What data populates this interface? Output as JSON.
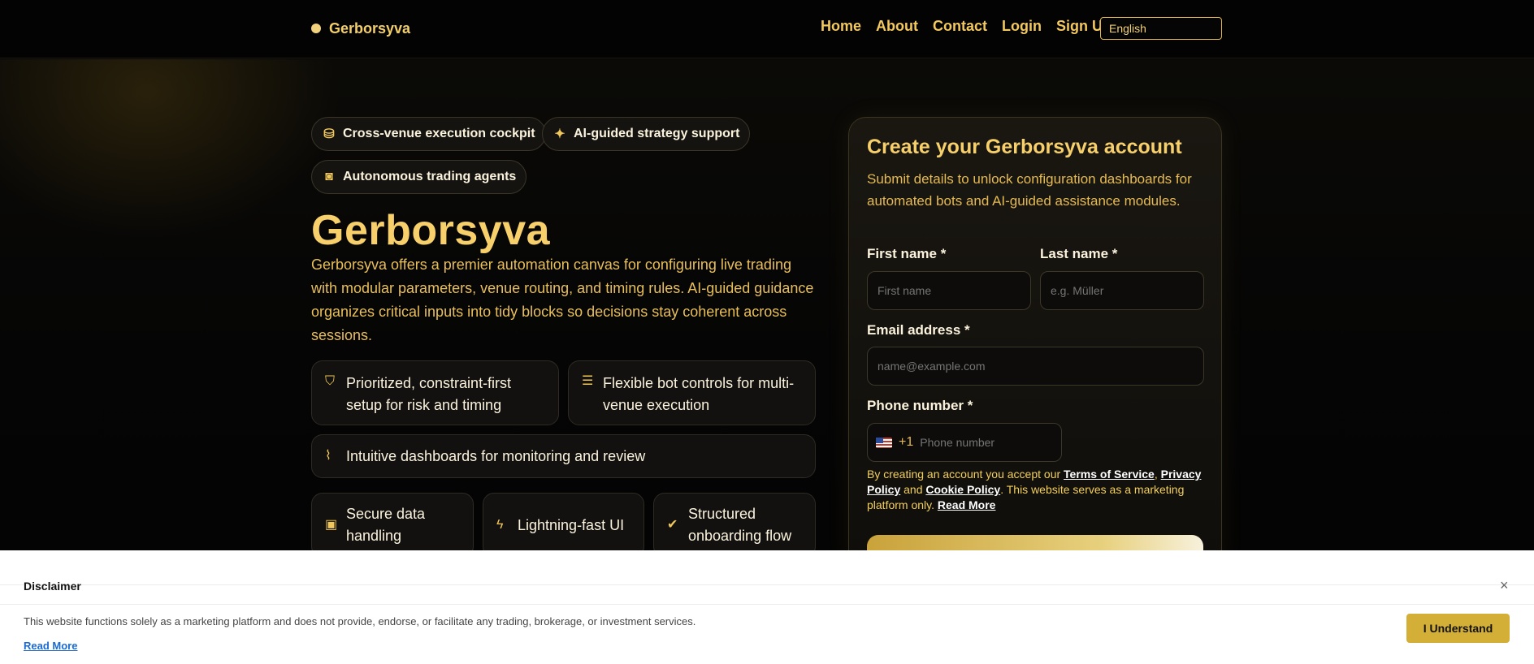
{
  "header": {
    "brand": "Gerborsyva",
    "nav": [
      "Home",
      "About",
      "Contact",
      "Login",
      "Sign Up"
    ],
    "language": "English"
  },
  "hero": {
    "pills": [
      {
        "label": "Cross-venue execution cockpit",
        "icon": "coins-icon"
      },
      {
        "label": "AI-guided strategy support",
        "icon": "magic-wand-icon"
      },
      {
        "label": "Autonomous trading agents",
        "icon": "robot-icon"
      }
    ],
    "title": "Gerborsyva",
    "lead": "Gerborsyva offers a premier automation canvas for configuring live trading with modular parameters, venue routing, and timing rules. AI-guided guidance organizes critical inputs into tidy blocks so decisions stay coherent across sessions.",
    "features": [
      {
        "label": "Prioritized, constraint-first setup for risk and timing",
        "icon": "shield-icon"
      },
      {
        "label": "Flexible bot controls for multi-venue execution",
        "icon": "sliders-icon"
      },
      {
        "label": "Intuitive dashboards for monitoring and review",
        "icon": "chart-line-icon"
      },
      {
        "label": "Secure data handling",
        "icon": "lock-icon"
      },
      {
        "label": "Lightning-fast UI",
        "icon": "bolt-icon"
      },
      {
        "label": "Structured onboarding flow",
        "icon": "check-circle-icon"
      }
    ]
  },
  "form": {
    "title": "Create your Gerborsyva account",
    "subtitle": "Submit details to unlock configuration dashboards for automated bots and AI-guided assistance modules.",
    "first_name_label": "First name *",
    "first_name_placeholder": "First name",
    "last_name_label": "Last name *",
    "last_name_placeholder": "e.g. Müller",
    "email_label": "Email address *",
    "email_placeholder": "name@example.com",
    "phone_label": "Phone number *",
    "phone_code": "+1",
    "phone_placeholder": "Phone number",
    "terms_prefix": "By creating an account you accept our ",
    "terms_of_service": "Terms of Service",
    "comma": ",",
    "privacy_policy": "Privacy Policy",
    "and": " and ",
    "cookie_policy": "Cookie Policy",
    "terms_suffix": ". This website serves as a marketing platform only. ",
    "read_more": "Read More"
  },
  "disclaimer": {
    "title": "Disclaimer",
    "message": "This website functions solely as a marketing platform and does not provide, endorse, or facilitate any trading, brokerage, or investment services.",
    "read_more": "Read More",
    "accept": "I Understand",
    "close_symbol": "×"
  }
}
